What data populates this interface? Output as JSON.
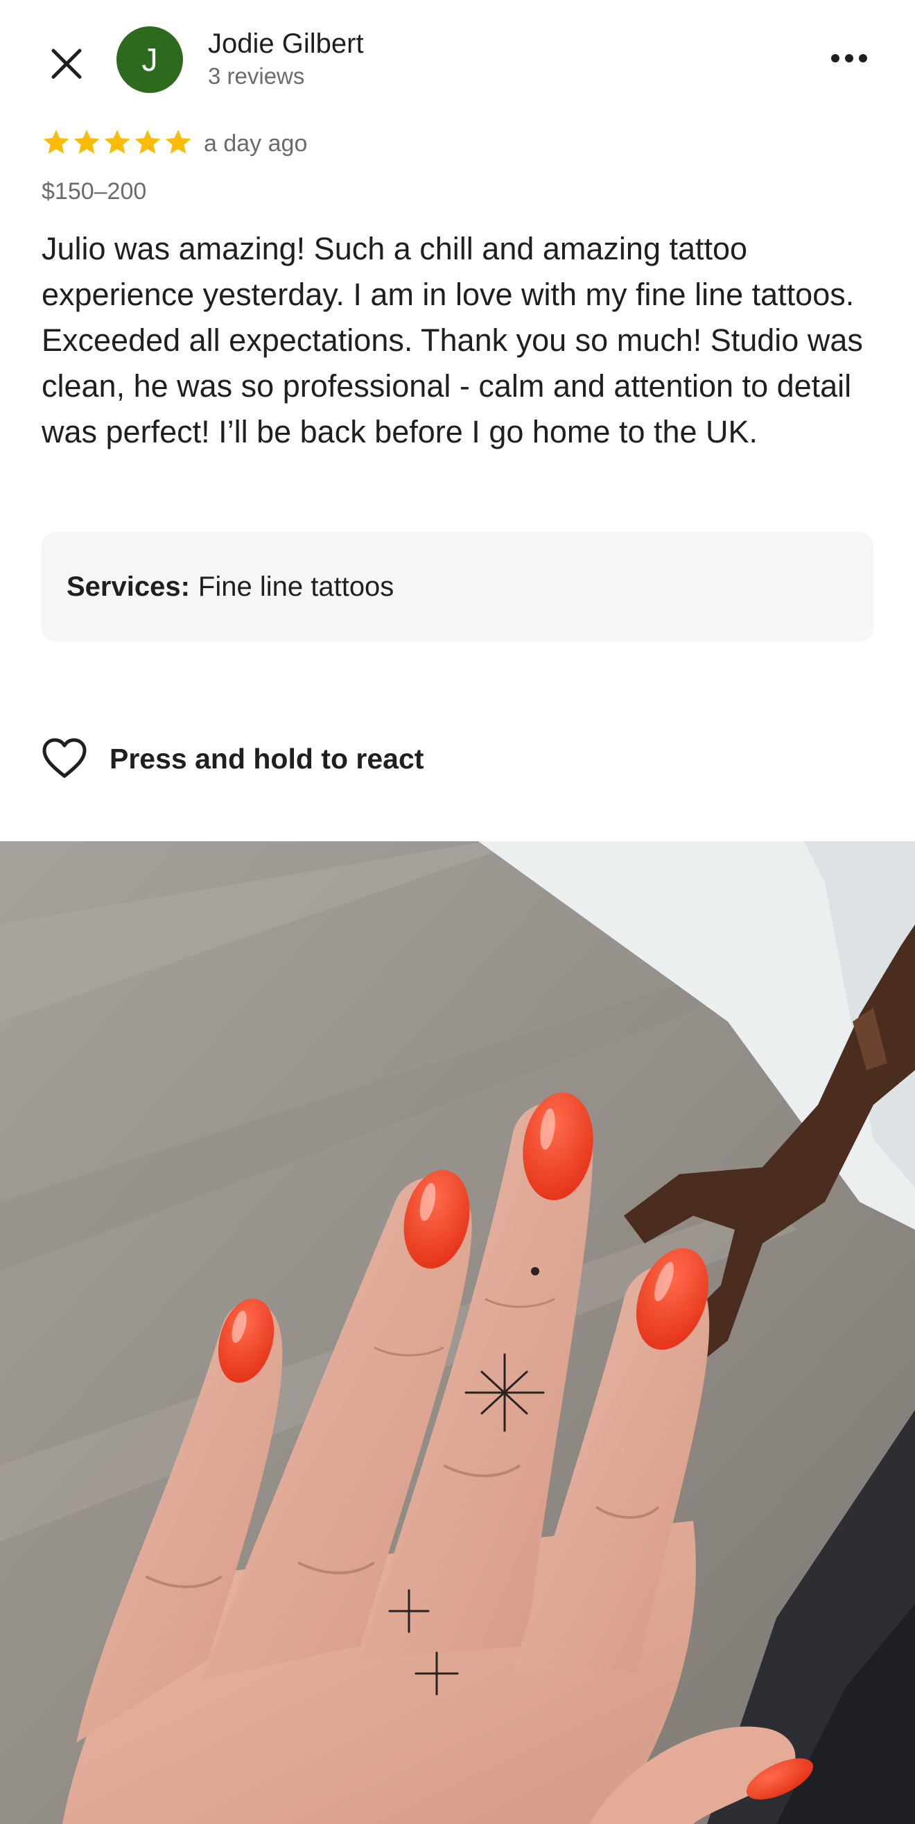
{
  "header": {
    "close_icon": "close-icon",
    "avatar_letter": "J",
    "avatar_color": "#2d6a1e",
    "reviewer_name": "Jodie Gilbert",
    "review_count": "3 reviews",
    "more_icon": "more-horizontal-icon"
  },
  "rating": {
    "stars": 5,
    "max_stars": 5,
    "star_color": "#fbbc04",
    "time_ago": "a day ago"
  },
  "price": "$150–200",
  "review": {
    "text": "Julio was amazing! Such a chill and amazing tattoo experience yesterday. I am in love with my fine line tattoos. Exceeded all expectations. Thank you so much! Studio was clean, he was so professional - calm and attention to detail was perfect! I’ll be back before I go home to the UK."
  },
  "services": {
    "label": "Services:",
    "value": "Fine line tattoos"
  },
  "react": {
    "icon": "heart-outline-icon",
    "label": "Press and hold to react"
  },
  "photo": {
    "subject": "hand-photo",
    "nail_color": "#f03a1e"
  }
}
